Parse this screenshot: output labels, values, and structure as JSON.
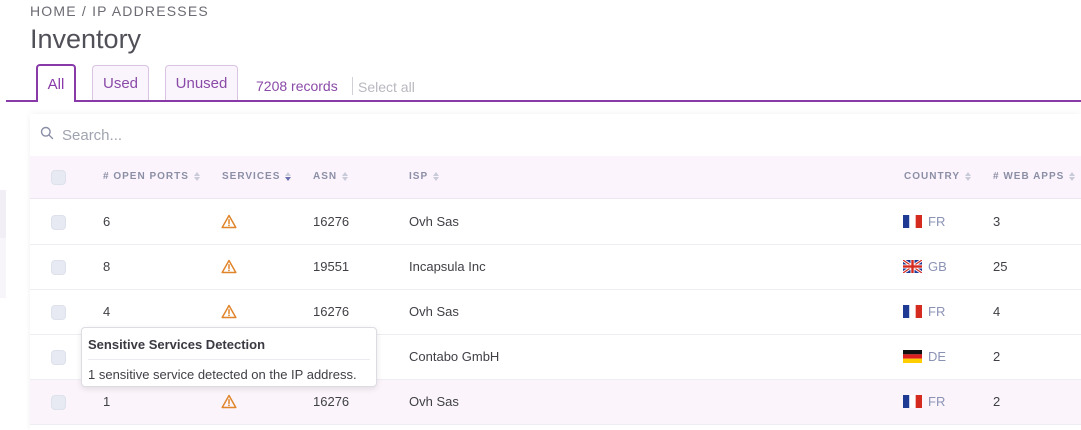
{
  "breadcrumb": "HOME / IP ADDRESSES",
  "page_title": "Inventory",
  "tabs": [
    {
      "label": "All",
      "active": true
    },
    {
      "label": "Used",
      "active": false
    },
    {
      "label": "Unused",
      "active": false
    }
  ],
  "records_count": "7208 records",
  "select_all": "Select all",
  "search": {
    "placeholder": "Search...",
    "value": ""
  },
  "columns": {
    "open_ports": "# OPEN PORTS",
    "services": "SERVICES",
    "asn": "ASN",
    "isp": "ISP",
    "country": "COUNTRY",
    "web_apps": "# WEB APPS"
  },
  "rows": [
    {
      "open_ports": "6",
      "services_icon": "warning-icon",
      "asn": "16276",
      "isp": "Ovh Sas",
      "country": "FR",
      "web_apps": "3"
    },
    {
      "open_ports": "8",
      "services_icon": "warning-icon",
      "asn": "19551",
      "isp": "Incapsula Inc",
      "country": "GB",
      "web_apps": "25"
    },
    {
      "open_ports": "4",
      "services_icon": "warning-icon",
      "asn": "16276",
      "isp": "Ovh Sas",
      "country": "FR",
      "web_apps": "4"
    },
    {
      "open_ports": "",
      "services_icon": "",
      "asn": "",
      "isp": "Contabo GmbH",
      "country": "DE",
      "web_apps": "2"
    },
    {
      "open_ports": "1",
      "services_icon": "warning-icon",
      "asn": "16276",
      "isp": "Ovh Sas",
      "country": "FR",
      "web_apps": "2"
    }
  ],
  "tooltip": {
    "title": "Sensitive Services Detection",
    "body": "1 sensitive service detected on the IP address."
  },
  "colors": {
    "accent": "#8a3aa8",
    "warning": "#e0852b",
    "header_bg": "#fcf4fc"
  }
}
